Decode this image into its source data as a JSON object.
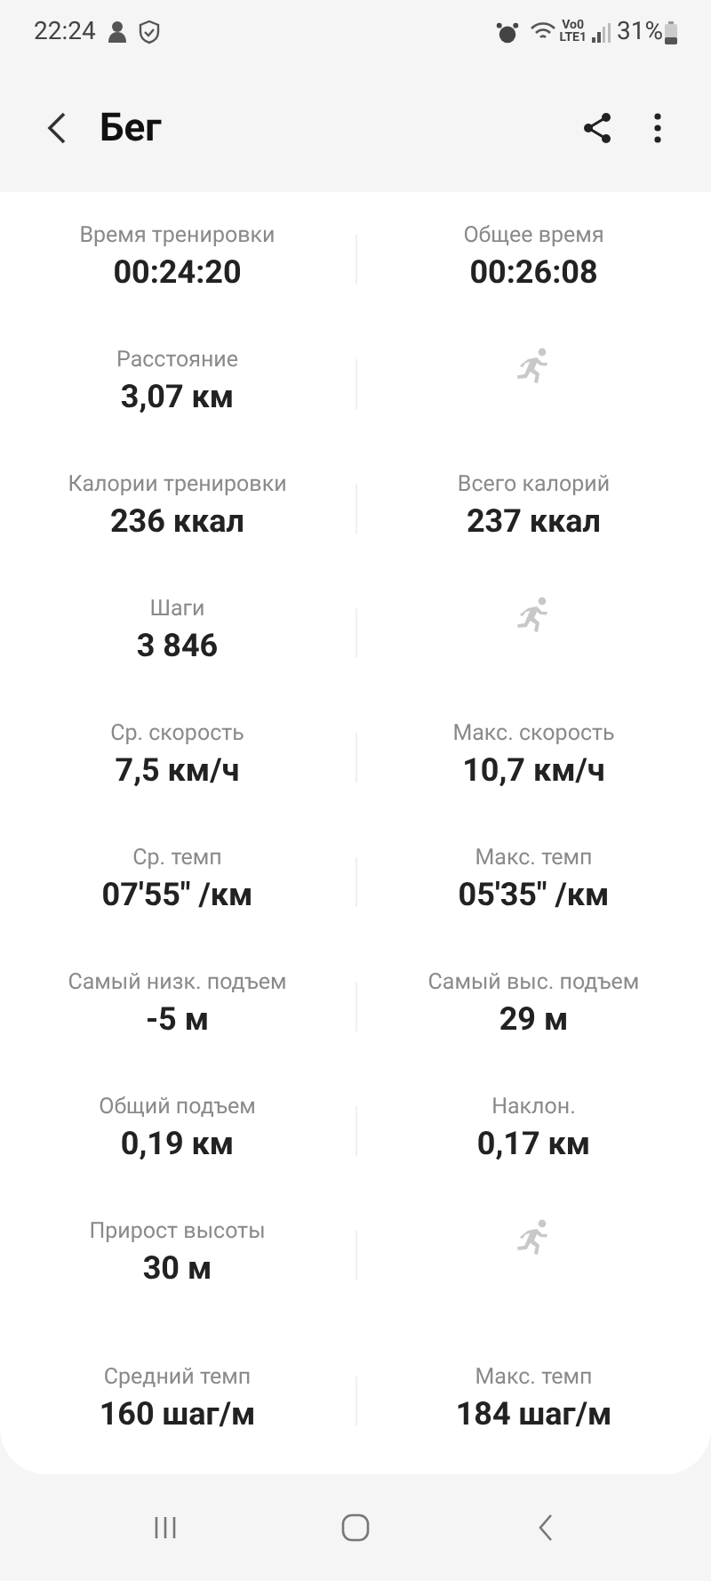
{
  "status_bar": {
    "time": "22:24",
    "network_top": "Vo0",
    "network_bottom": "LTE1",
    "battery": "31%"
  },
  "header": {
    "title": "Бег"
  },
  "rows": [
    {
      "left": {
        "kind": "metric",
        "label": "Время тренировки",
        "value": "00:24:20"
      },
      "right": {
        "kind": "metric",
        "label": "Общее время",
        "value": "00:26:08"
      }
    },
    {
      "left": {
        "kind": "metric",
        "label": "Расстояние",
        "value": "3,07 км"
      },
      "right": {
        "kind": "icon"
      }
    },
    {
      "left": {
        "kind": "metric",
        "label": "Калории тренировки",
        "value": "236 ккал"
      },
      "right": {
        "kind": "metric",
        "label": "Всего калорий",
        "value": "237 ккал"
      }
    },
    {
      "left": {
        "kind": "metric",
        "label": "Шаги",
        "value": "3 846"
      },
      "right": {
        "kind": "icon"
      }
    },
    {
      "left": {
        "kind": "metric",
        "label": "Ср. скорость",
        "value": "7,5 км/ч"
      },
      "right": {
        "kind": "metric",
        "label": "Макс. скорость",
        "value": "10,7 км/ч"
      }
    },
    {
      "left": {
        "kind": "metric",
        "label": "Ср. темп",
        "value": "07'55\" /км"
      },
      "right": {
        "kind": "metric",
        "label": "Макс. темп",
        "value": "05'35\" /км"
      }
    },
    {
      "left": {
        "kind": "metric",
        "label": "Самый низк. подъем",
        "value": "-5 м"
      },
      "right": {
        "kind": "metric",
        "label": "Самый выс. подъем",
        "value": "29 м"
      }
    },
    {
      "left": {
        "kind": "metric",
        "label": "Общий подъем",
        "value": "0,19 км"
      },
      "right": {
        "kind": "metric",
        "label": "Наклон.",
        "value": "0,17 км"
      }
    },
    {
      "left": {
        "kind": "metric",
        "label": "Прирост высоты",
        "value": "30 м"
      },
      "right": {
        "kind": "icon"
      }
    },
    {
      "left": {
        "kind": "metric",
        "label": "Средний темп",
        "value": "160 шаг/м"
      },
      "right": {
        "kind": "metric",
        "label": "Макс. темп",
        "value": "184 шаг/м"
      }
    }
  ]
}
